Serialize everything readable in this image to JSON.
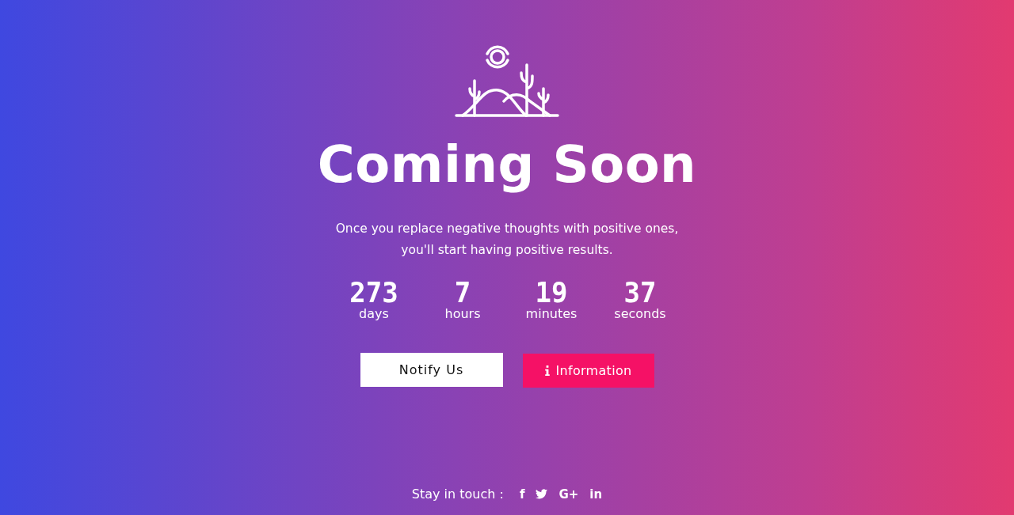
{
  "title": "Coming Soon",
  "subtitle": "Once you replace negative thoughts with positive ones, you'll start having positive results.",
  "countdown": [
    {
      "value": "273",
      "unit": "days"
    },
    {
      "value": "7",
      "unit": "hours"
    },
    {
      "value": "19",
      "unit": "minutes"
    },
    {
      "value": "37",
      "unit": "seconds"
    }
  ],
  "buttons": [
    {
      "kind": "plain",
      "label": "Notify Us"
    },
    {
      "kind": "info",
      "label": "Information"
    }
  ],
  "footer": {
    "label": "Stay in touch :",
    "social": [
      {
        "kind": "glyph",
        "label": "f"
      },
      {
        "kind": "twitter"
      },
      {
        "kind": "glyph",
        "label": "G+"
      },
      {
        "kind": "glyph",
        "label": "in"
      }
    ]
  }
}
